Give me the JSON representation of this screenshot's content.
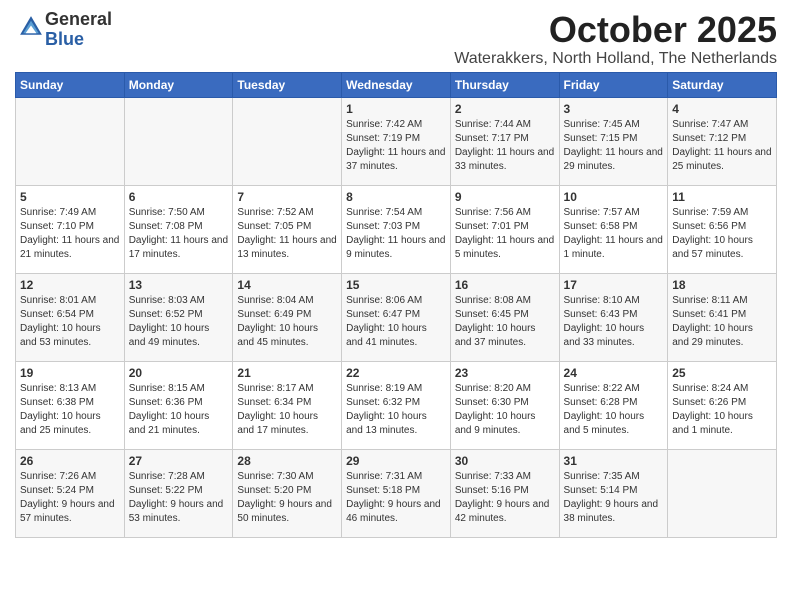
{
  "header": {
    "logo_general": "General",
    "logo_blue": "Blue",
    "month": "October 2025",
    "location": "Waterakkers, North Holland, The Netherlands"
  },
  "days_of_week": [
    "Sunday",
    "Monday",
    "Tuesday",
    "Wednesday",
    "Thursday",
    "Friday",
    "Saturday"
  ],
  "weeks": [
    [
      {
        "day": "",
        "info": ""
      },
      {
        "day": "",
        "info": ""
      },
      {
        "day": "",
        "info": ""
      },
      {
        "day": "1",
        "info": "Sunrise: 7:42 AM\nSunset: 7:19 PM\nDaylight: 11 hours\nand 37 minutes."
      },
      {
        "day": "2",
        "info": "Sunrise: 7:44 AM\nSunset: 7:17 PM\nDaylight: 11 hours\nand 33 minutes."
      },
      {
        "day": "3",
        "info": "Sunrise: 7:45 AM\nSunset: 7:15 PM\nDaylight: 11 hours\nand 29 minutes."
      },
      {
        "day": "4",
        "info": "Sunrise: 7:47 AM\nSunset: 7:12 PM\nDaylight: 11 hours\nand 25 minutes."
      }
    ],
    [
      {
        "day": "5",
        "info": "Sunrise: 7:49 AM\nSunset: 7:10 PM\nDaylight: 11 hours\nand 21 minutes."
      },
      {
        "day": "6",
        "info": "Sunrise: 7:50 AM\nSunset: 7:08 PM\nDaylight: 11 hours\nand 17 minutes."
      },
      {
        "day": "7",
        "info": "Sunrise: 7:52 AM\nSunset: 7:05 PM\nDaylight: 11 hours\nand 13 minutes."
      },
      {
        "day": "8",
        "info": "Sunrise: 7:54 AM\nSunset: 7:03 PM\nDaylight: 11 hours\nand 9 minutes."
      },
      {
        "day": "9",
        "info": "Sunrise: 7:56 AM\nSunset: 7:01 PM\nDaylight: 11 hours\nand 5 minutes."
      },
      {
        "day": "10",
        "info": "Sunrise: 7:57 AM\nSunset: 6:58 PM\nDaylight: 11 hours\nand 1 minute."
      },
      {
        "day": "11",
        "info": "Sunrise: 7:59 AM\nSunset: 6:56 PM\nDaylight: 10 hours\nand 57 minutes."
      }
    ],
    [
      {
        "day": "12",
        "info": "Sunrise: 8:01 AM\nSunset: 6:54 PM\nDaylight: 10 hours\nand 53 minutes."
      },
      {
        "day": "13",
        "info": "Sunrise: 8:03 AM\nSunset: 6:52 PM\nDaylight: 10 hours\nand 49 minutes."
      },
      {
        "day": "14",
        "info": "Sunrise: 8:04 AM\nSunset: 6:49 PM\nDaylight: 10 hours\nand 45 minutes."
      },
      {
        "day": "15",
        "info": "Sunrise: 8:06 AM\nSunset: 6:47 PM\nDaylight: 10 hours\nand 41 minutes."
      },
      {
        "day": "16",
        "info": "Sunrise: 8:08 AM\nSunset: 6:45 PM\nDaylight: 10 hours\nand 37 minutes."
      },
      {
        "day": "17",
        "info": "Sunrise: 8:10 AM\nSunset: 6:43 PM\nDaylight: 10 hours\nand 33 minutes."
      },
      {
        "day": "18",
        "info": "Sunrise: 8:11 AM\nSunset: 6:41 PM\nDaylight: 10 hours\nand 29 minutes."
      }
    ],
    [
      {
        "day": "19",
        "info": "Sunrise: 8:13 AM\nSunset: 6:38 PM\nDaylight: 10 hours\nand 25 minutes."
      },
      {
        "day": "20",
        "info": "Sunrise: 8:15 AM\nSunset: 6:36 PM\nDaylight: 10 hours\nand 21 minutes."
      },
      {
        "day": "21",
        "info": "Sunrise: 8:17 AM\nSunset: 6:34 PM\nDaylight: 10 hours\nand 17 minutes."
      },
      {
        "day": "22",
        "info": "Sunrise: 8:19 AM\nSunset: 6:32 PM\nDaylight: 10 hours\nand 13 minutes."
      },
      {
        "day": "23",
        "info": "Sunrise: 8:20 AM\nSunset: 6:30 PM\nDaylight: 10 hours\nand 9 minutes."
      },
      {
        "day": "24",
        "info": "Sunrise: 8:22 AM\nSunset: 6:28 PM\nDaylight: 10 hours\nand 5 minutes."
      },
      {
        "day": "25",
        "info": "Sunrise: 8:24 AM\nSunset: 6:26 PM\nDaylight: 10 hours\nand 1 minute."
      }
    ],
    [
      {
        "day": "26",
        "info": "Sunrise: 7:26 AM\nSunset: 5:24 PM\nDaylight: 9 hours\nand 57 minutes."
      },
      {
        "day": "27",
        "info": "Sunrise: 7:28 AM\nSunset: 5:22 PM\nDaylight: 9 hours\nand 53 minutes."
      },
      {
        "day": "28",
        "info": "Sunrise: 7:30 AM\nSunset: 5:20 PM\nDaylight: 9 hours\nand 50 minutes."
      },
      {
        "day": "29",
        "info": "Sunrise: 7:31 AM\nSunset: 5:18 PM\nDaylight: 9 hours\nand 46 minutes."
      },
      {
        "day": "30",
        "info": "Sunrise: 7:33 AM\nSunset: 5:16 PM\nDaylight: 9 hours\nand 42 minutes."
      },
      {
        "day": "31",
        "info": "Sunrise: 7:35 AM\nSunset: 5:14 PM\nDaylight: 9 hours\nand 38 minutes."
      },
      {
        "day": "",
        "info": ""
      }
    ]
  ]
}
